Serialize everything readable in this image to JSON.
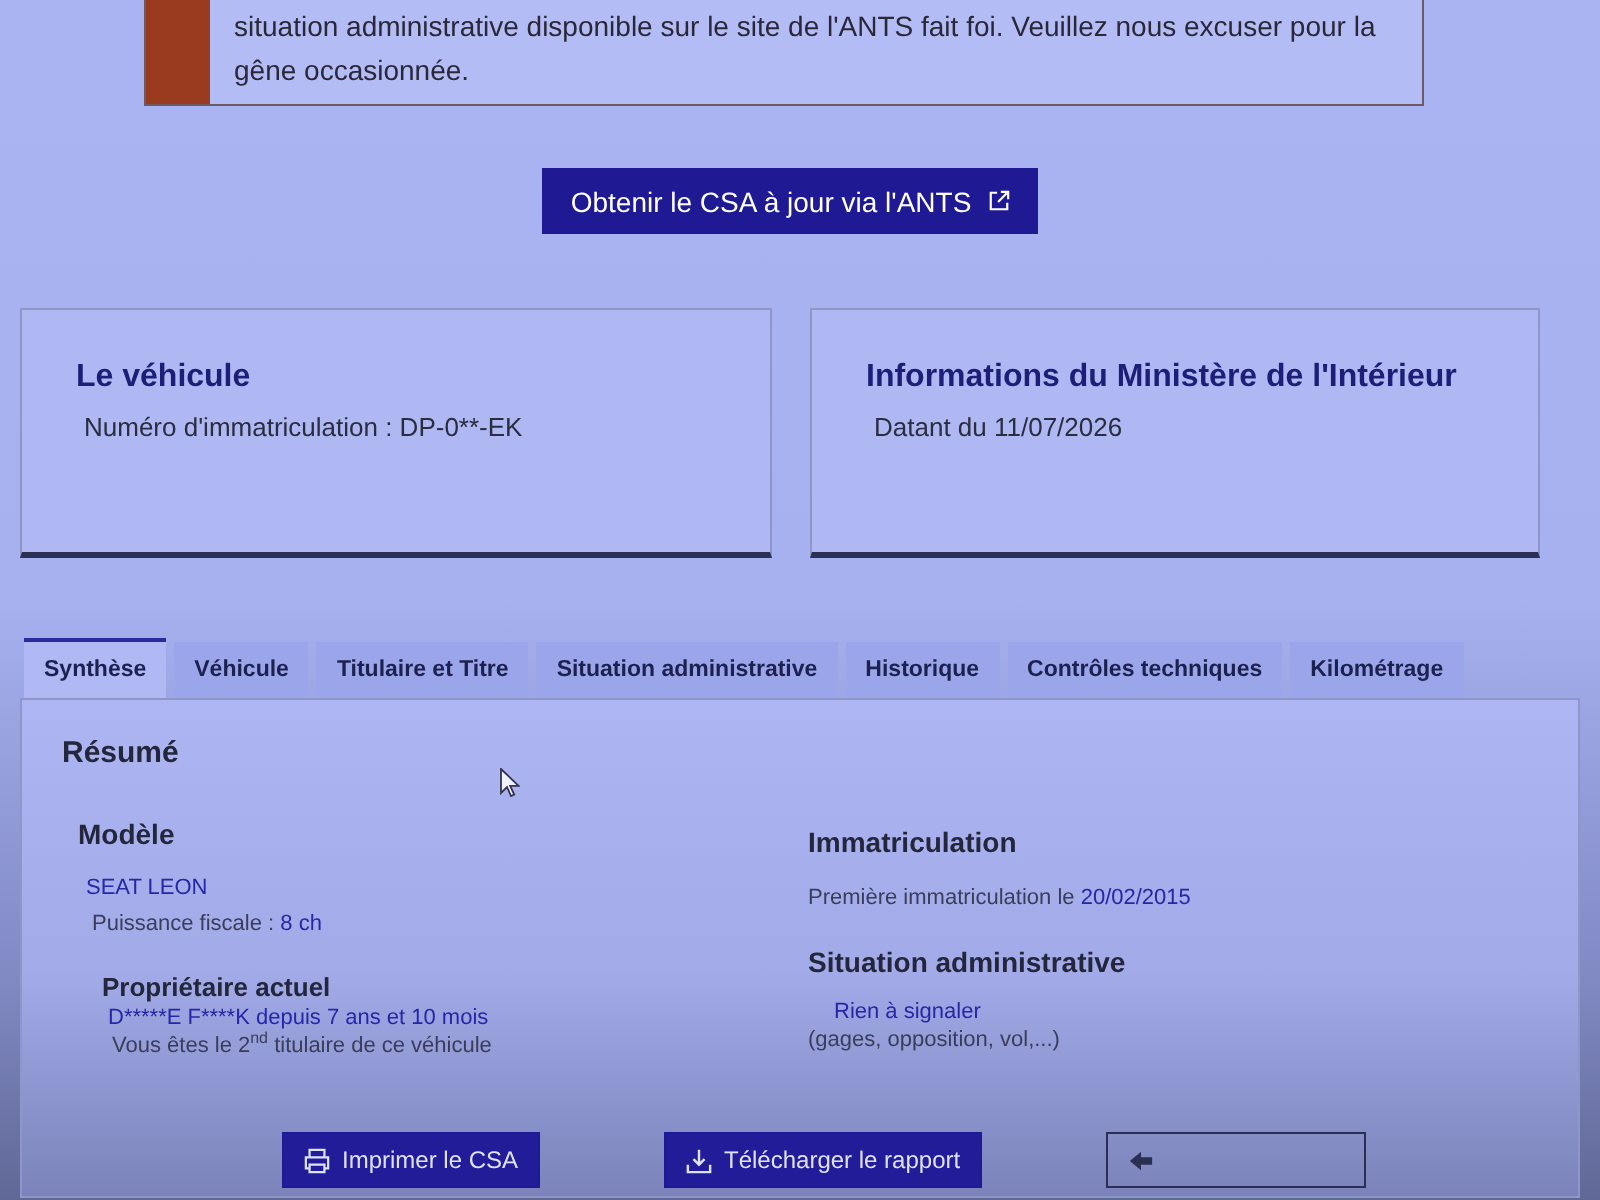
{
  "alert": {
    "text": "situation administrative disponible sur le site de l'ANTS fait foi. Veuillez nous excuser pour la gêne occasionnée."
  },
  "cta_button": {
    "label": "Obtenir le CSA à jour via l'ANTS"
  },
  "cards": [
    {
      "title": "Le véhicule",
      "text": "Numéro d'immatriculation : DP-0**-EK"
    },
    {
      "title": "Informations du Ministère de l'Intérieur",
      "text": "Datant du 11/07/2026"
    }
  ],
  "tabs": [
    {
      "label": "Synthèse",
      "selected": true
    },
    {
      "label": "Véhicule",
      "selected": false
    },
    {
      "label": "Titulaire et Titre",
      "selected": false
    },
    {
      "label": "Situation administrative",
      "selected": false
    },
    {
      "label": "Historique",
      "selected": false
    },
    {
      "label": "Contrôles techniques",
      "selected": false
    },
    {
      "label": "Kilométrage",
      "selected": false
    }
  ],
  "summary": {
    "title": "Résumé",
    "model": {
      "heading": "Modèle",
      "name": "SEAT LEON",
      "power_label": "Puissance fiscale :",
      "power_value": "8 ch"
    },
    "owner": {
      "heading": "Propriétaire actuel",
      "name": "D*****E F****K depuis 7 ans et 10 mois",
      "note": "Vous êtes le 2$^{nd}$ titulaire de ce véhicule"
    },
    "registration": {
      "heading": "Immatriculation",
      "label": "Première immatriculation le",
      "date": "20/02/2015"
    },
    "admin_status": {
      "heading": "Situation administrative",
      "status": "Rien à signaler",
      "note": "(gages, opposition, vol,...)"
    }
  },
  "actions": [
    {
      "kind": "print",
      "label": "Imprimer le CSA"
    },
    {
      "kind": "download",
      "label": "Télécharger le rapport"
    },
    {
      "kind": "back"
    }
  ]
}
